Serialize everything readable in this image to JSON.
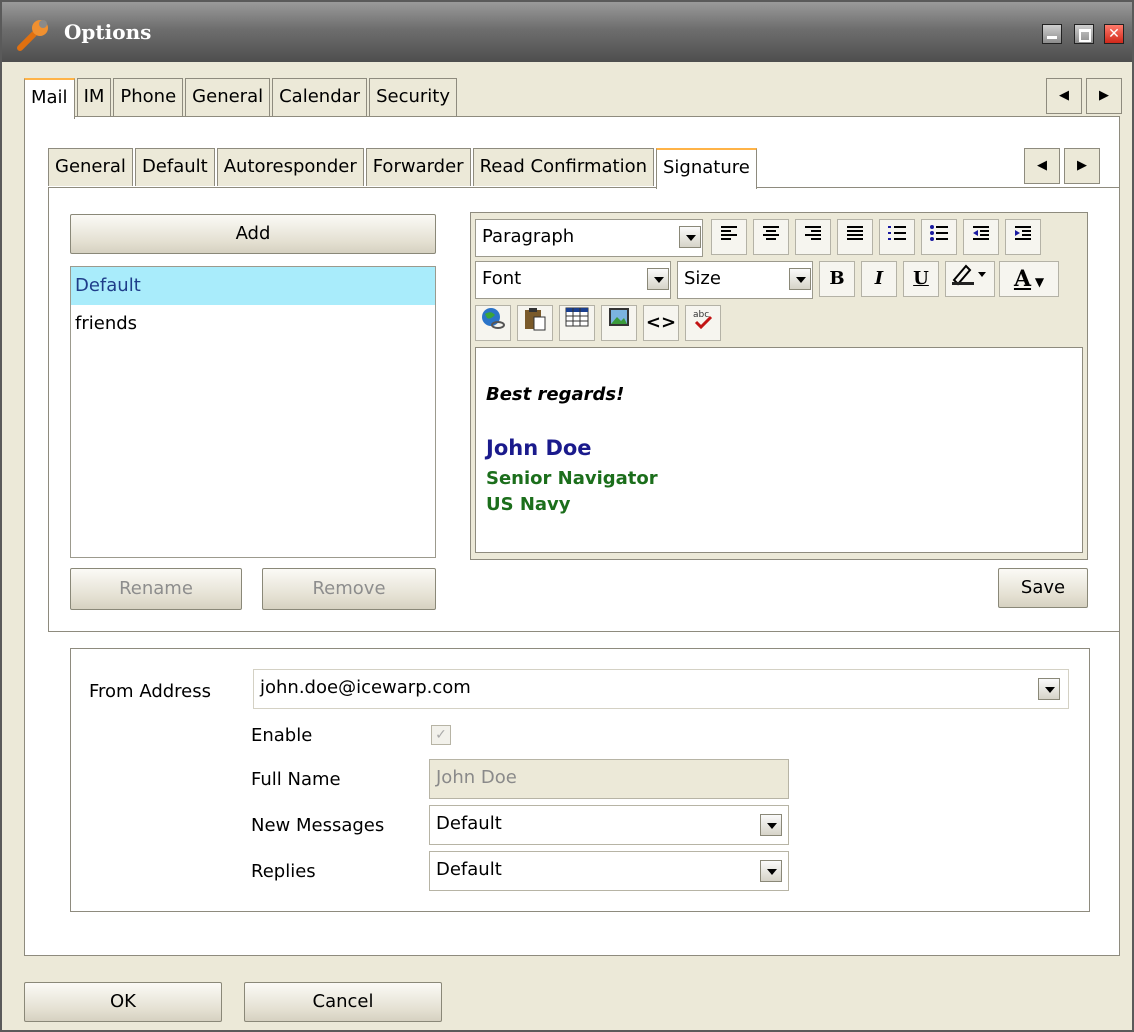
{
  "window": {
    "title": "Options"
  },
  "outer_tabs": [
    "Mail",
    "IM",
    "Phone",
    "General",
    "Calendar",
    "Security"
  ],
  "inner_tabs": [
    "General",
    "Default",
    "Autoresponder",
    "Forwarder",
    "Read Confirmation",
    "Signature"
  ],
  "signatures": {
    "add_label": "Add",
    "items": [
      "Default",
      "friends"
    ],
    "rename_label": "Rename",
    "remove_label": "Remove"
  },
  "editor": {
    "paragraph_value": "Paragraph",
    "font_value": "Font",
    "size_value": "Size",
    "bold": "B",
    "italic": "I",
    "underline": "U",
    "font_color": "A",
    "source": "<>",
    "content": {
      "line1": "Best regards!",
      "name": "John Doe",
      "position": "Senior Navigator",
      "org": "US Navy"
    },
    "colors": {
      "name": "#1a1a8c",
      "position": "#1b6e1b"
    }
  },
  "save_label": "Save",
  "form": {
    "from_address_label": "From Address",
    "from_address_value": "john.doe@icewarp.com",
    "enable_label": "Enable",
    "enable_checked": true,
    "full_name_label": "Full Name",
    "full_name_value": "John Doe",
    "new_messages_label": "New Messages",
    "new_messages_value": "Default",
    "replies_label": "Replies",
    "replies_value": "Default"
  },
  "footer": {
    "ok_label": "OK",
    "cancel_label": "Cancel"
  }
}
